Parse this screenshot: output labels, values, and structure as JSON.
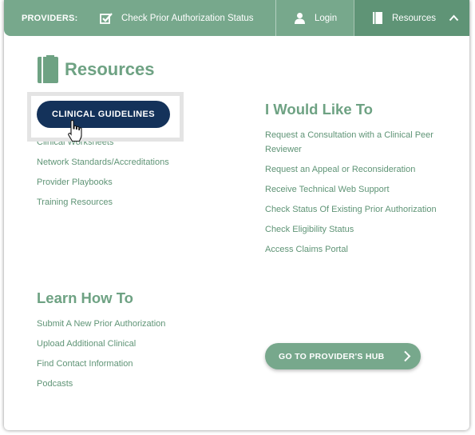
{
  "topbar": {
    "providers_label": "PROVIDERS:",
    "check_status_label": "Check Prior Authorization Status",
    "login_label": "Login",
    "resources_label": "Resources"
  },
  "resources": {
    "title": "Resources",
    "clinical_guidelines_button": "CLINICAL GUIDELINES",
    "links": [
      "Clinical Worksheets",
      "Network Standards/Accreditations",
      "Provider Playbooks",
      "Training Resources"
    ]
  },
  "would_like_to": {
    "title": "I Would Like To",
    "links": [
      "Request a Consultation with a Clinical Peer Reviewer",
      "Request an Appeal or Reconsideration",
      "Receive Technical Web Support",
      "Check Status Of Existing Prior Authorization",
      "Check Eligibility Status",
      "Access Claims Portal"
    ]
  },
  "learn_how_to": {
    "title": "Learn How To",
    "links": [
      "Submit A New Prior Authorization",
      "Upload Additional Clinical",
      "Find Contact Information",
      "Podcasts"
    ]
  },
  "hub_button": {
    "label": "GO TO PROVIDER'S HUB"
  },
  "colors": {
    "brand_green": "#77a88c",
    "active_green": "#5f9476",
    "navy": "#14325a",
    "heading_green": "#6ea283"
  },
  "icons": [
    "checkbox-icon",
    "user-icon",
    "book-icon",
    "chevron-up-icon",
    "chevron-right-icon",
    "hand-cursor-icon"
  ]
}
